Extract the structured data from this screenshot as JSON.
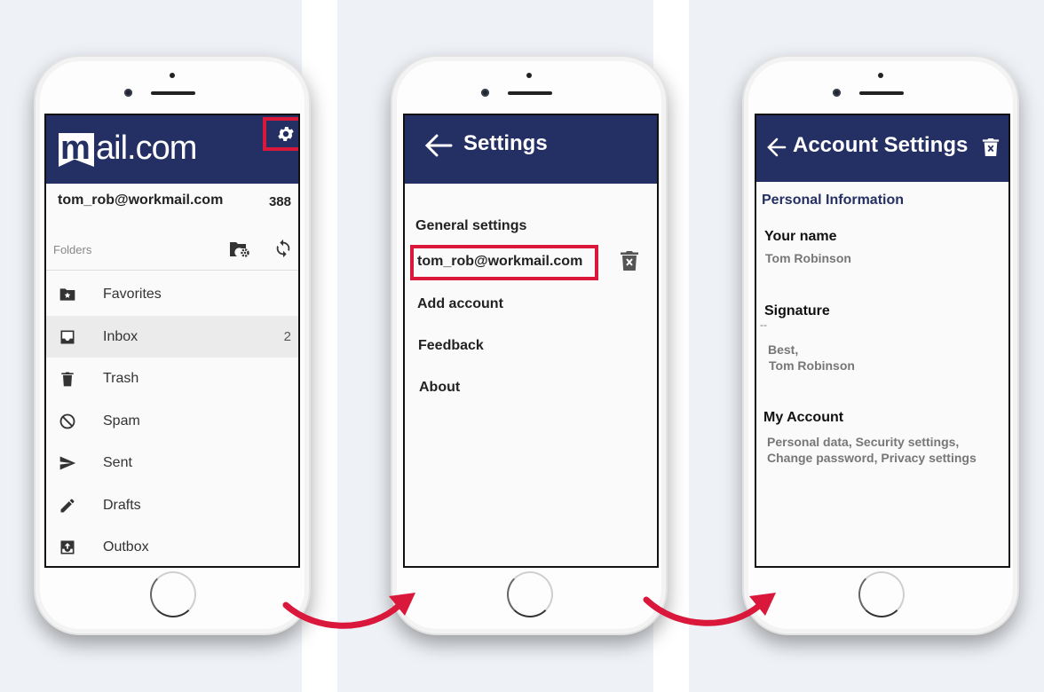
{
  "screen1": {
    "logo_m": "m",
    "logo_text": "ail.com",
    "account_email": "tom_rob@workmail.com",
    "account_count": "388",
    "folders_label": "Folders",
    "folders": [
      {
        "label": "Favorites",
        "icon": "star-folder-icon",
        "count": ""
      },
      {
        "label": "Inbox",
        "icon": "inbox-icon",
        "count": "2",
        "active": true
      },
      {
        "label": "Trash",
        "icon": "trash-icon",
        "count": ""
      },
      {
        "label": "Spam",
        "icon": "block-icon",
        "count": ""
      },
      {
        "label": "Sent",
        "icon": "send-icon",
        "count": ""
      },
      {
        "label": "Drafts",
        "icon": "pencil-icon",
        "count": ""
      },
      {
        "label": "Outbox",
        "icon": "outbox-icon",
        "count": ""
      }
    ]
  },
  "screen2": {
    "title": "Settings",
    "items": [
      "General settings",
      "tom_rob@workmail.com",
      "Add account",
      "Feedback",
      "About"
    ]
  },
  "screen3": {
    "title": "Account Settings",
    "section": "Personal Information",
    "your_name_label": "Your name",
    "your_name_value": "Tom Robinson",
    "signature_label": "Signature",
    "signature_dash": "--",
    "signature_line1": "Best,",
    "signature_line2": "Tom Robinson",
    "my_account_label": "My Account",
    "my_account_line1": "Personal data, Security settings,",
    "my_account_line2": "Change password, Privacy settings"
  },
  "colors": {
    "header": "#243063",
    "highlight": "#d9183b",
    "arrow": "#d9183b"
  }
}
